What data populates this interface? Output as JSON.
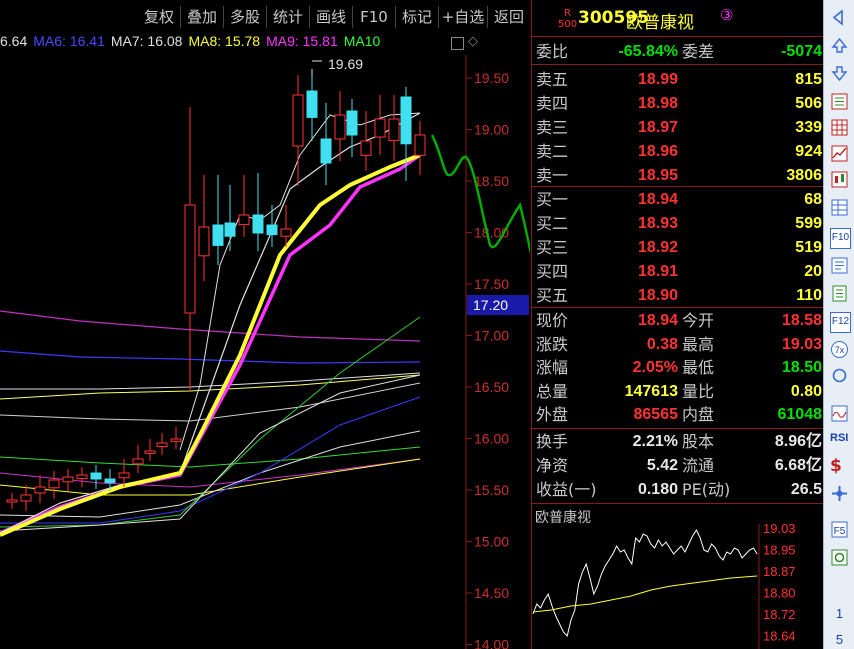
{
  "toolbar": {
    "buttons": [
      "复权",
      "叠加",
      "多股",
      "统计",
      "画线",
      "F10",
      "标记",
      "+自选",
      "返回"
    ]
  },
  "ma_legend": [
    {
      "label": "6.64",
      "color": "#e0e0e0"
    },
    {
      "label": "MA6: 16.41",
      "color": "#1a1aff"
    },
    {
      "label": "MA7: 16.08",
      "color": "#e0e0e0"
    },
    {
      "label": "MA8: 15.78",
      "color": "#ffff33"
    },
    {
      "label": "MA9: 15.81",
      "color": "#ff33ff"
    },
    {
      "label": "MA10",
      "color": "#33ff33"
    }
  ],
  "chart": {
    "high_marker": "19.69",
    "y_ticks": [
      "19.50",
      "19.00",
      "18.50",
      "18.00",
      "17.50",
      "17.00",
      "16.50",
      "16.00",
      "15.50",
      "15.00",
      "14.50",
      "14.00"
    ],
    "price_tag": "17.20"
  },
  "stock": {
    "badge_top": "R",
    "badge_bottom": "500",
    "code": "300595",
    "name": "欧普康视",
    "circle_num": "③"
  },
  "weibi": {
    "label": "委比",
    "value": "-65.84%",
    "label2": "委差",
    "value2": "-5074"
  },
  "asks": [
    {
      "label": "卖五",
      "price": "18.99",
      "vol": "815"
    },
    {
      "label": "卖四",
      "price": "18.98",
      "vol": "506"
    },
    {
      "label": "卖三",
      "price": "18.97",
      "vol": "339"
    },
    {
      "label": "卖二",
      "price": "18.96",
      "vol": "924"
    },
    {
      "label": "卖一",
      "price": "18.95",
      "vol": "3806"
    }
  ],
  "bids": [
    {
      "label": "买一",
      "price": "18.94",
      "vol": "68"
    },
    {
      "label": "买二",
      "price": "18.93",
      "vol": "599"
    },
    {
      "label": "买三",
      "price": "18.92",
      "vol": "519"
    },
    {
      "label": "买四",
      "price": "18.91",
      "vol": "20"
    },
    {
      "label": "买五",
      "price": "18.90",
      "vol": "110"
    }
  ],
  "quote": [
    {
      "l1": "现价",
      "v1": "18.94",
      "c1": "red",
      "l2": "今开",
      "v2": "18.58",
      "c2": "red"
    },
    {
      "l1": "涨跌",
      "v1": "0.38",
      "c1": "red",
      "l2": "最高",
      "v2": "19.03",
      "c2": "red"
    },
    {
      "l1": "涨幅",
      "v1": "2.05%",
      "c1": "red",
      "l2": "最低",
      "v2": "18.50",
      "c2": "green"
    },
    {
      "l1": "总量",
      "v1": "147613",
      "c1": "yellow",
      "l2": "量比",
      "v2": "0.80",
      "c2": "yellow"
    },
    {
      "l1": "外盘",
      "v1": "86565",
      "c1": "red",
      "l2": "内盘",
      "v2": "61048",
      "c2": "green"
    }
  ],
  "fundamentals": [
    {
      "l1": "换手",
      "v1": "2.21%",
      "l2": "股本",
      "v2": "8.96亿"
    },
    {
      "l1": "净资",
      "v1": "5.42",
      "l2": "流通",
      "v2": "6.68亿"
    },
    {
      "l1": "收益(一)",
      "v1": "0.180",
      "l2": "PE(动)",
      "v2": "26.5"
    }
  ],
  "mini_chart": {
    "title": "欧普康视",
    "y_labels": [
      "19.03",
      "18.95",
      "18.87",
      "18.80",
      "18.72",
      "18.64"
    ]
  },
  "sidebar": {
    "bottom_numbers": [
      "1",
      "5"
    ]
  }
}
